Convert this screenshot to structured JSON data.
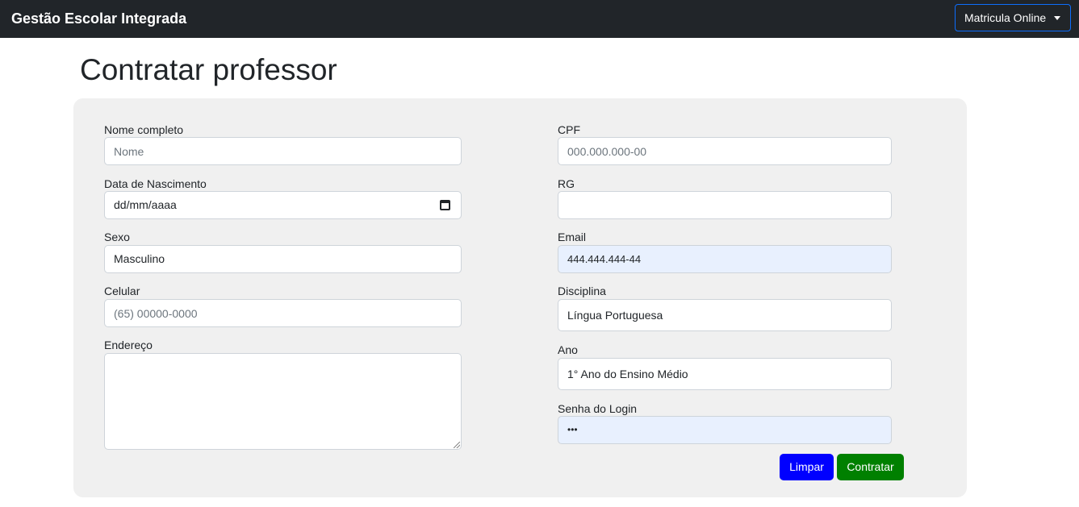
{
  "navbar": {
    "brand": "Gestão Escolar Integrada",
    "dropdown_label": "Matricula Online"
  },
  "page": {
    "title": "Contratar professor"
  },
  "form": {
    "nome": {
      "label": "Nome completo",
      "placeholder": "Nome",
      "value": ""
    },
    "nascimento": {
      "label": "Data de Nascimento",
      "value": "dd/mm/aaaa"
    },
    "sexo": {
      "label": "Sexo",
      "value": "Masculino"
    },
    "celular": {
      "label": "Celular",
      "placeholder": "(65) 00000-0000",
      "value": ""
    },
    "endereco": {
      "label": "Endereço",
      "value": ""
    },
    "cpf": {
      "label": "CPF",
      "placeholder": "000.000.000-00",
      "value": ""
    },
    "rg": {
      "label": "RG",
      "value": ""
    },
    "email": {
      "label": "Email",
      "value": "444.444.444-44"
    },
    "disciplina": {
      "label": "Disciplina",
      "value": "Língua Portuguesa"
    },
    "ano": {
      "label": "Ano",
      "value": "1° Ano do Ensino Médio"
    },
    "senha": {
      "label": "Senha do Login",
      "value": "•••"
    }
  },
  "buttons": {
    "limpar": "Limpar",
    "contratar": "Contratar"
  },
  "colors": {
    "navbar": "#212529",
    "panel": "#f0f0f0",
    "limpar_button": "#0000ff",
    "contratar_button": "#008000",
    "autofill": "#e8f0fe"
  }
}
